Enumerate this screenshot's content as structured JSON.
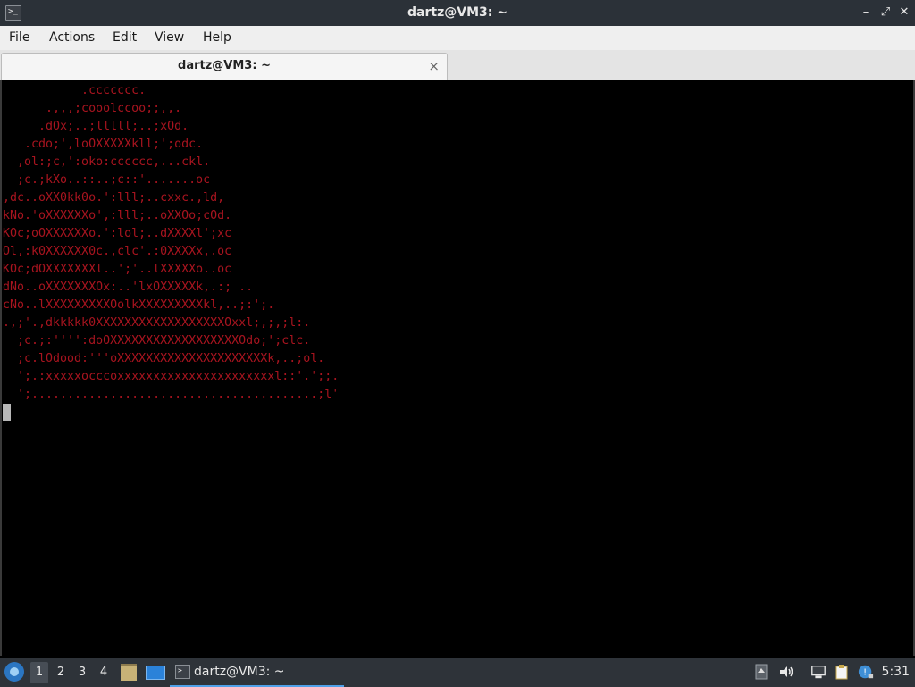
{
  "window": {
    "title": "dartz@VM3: ~",
    "app_icon": "terminal-icon",
    "buttons": [
      "minimize-icon",
      "maximize-icon",
      "close-icon"
    ]
  },
  "menu": {
    "file": "File",
    "actions": "Actions",
    "edit": "Edit",
    "view": "View",
    "help": "Help"
  },
  "tab": {
    "label": "dartz@VM3: ~",
    "close_glyph": "×"
  },
  "terminal": {
    "text_color": "#a8141f",
    "output": "           .ccccccc.\n      .,,,;cooolccoo;;,,.\n     .dOx;..;lllll;..;xOd.\n   .cdo;',loOXXXXXkll;';odc.\n  ,ol:;c,':oko:cccccc,...ckl.\n  ;c.;kXo..::..;c::'.......oc\n,dc..oXX0kk0o.':lll;..cxxc.,ld,\nkNo.'oXXXXXXo',:lll;..oXXOo;cOd.\nKOc;oOXXXXXXo.':lol;..dXXXXl';xc\nOl,:k0XXXXXX0c.,clc'.:0XXXXx,.oc\nKOc;dOXXXXXXXl..';'..lXXXXXo..oc\ndNo..oXXXXXXXOx:..'lxOXXXXXk,.:; ..\ncNo..lXXXXXXXXXOolkXXXXXXXXXkl,..;:';.\n.,;'.,dkkkkk0XXXXXXXXXXXXXXXXXXOxxl;,;,;l:.\n  ;c.;:'''':doOXXXXXXXXXXXXXXXXXXOdo;';clc.\n  ;c.lOdood:'''oXXXXXXXXXXXXXXXXXXXXXk,..;ol.\n  ';.:xxxxxocccoxxxxxxxxxxxxxxxxxxxxxxl::'.';;.\n  ';........................................;l'"
  },
  "taskbar": {
    "start_icon": "lxqt-menu-icon",
    "workspaces": [
      "1",
      "2",
      "3",
      "4"
    ],
    "active_workspace": "1",
    "task_label": "dartz@VM3: ~",
    "clock": "5:31"
  }
}
